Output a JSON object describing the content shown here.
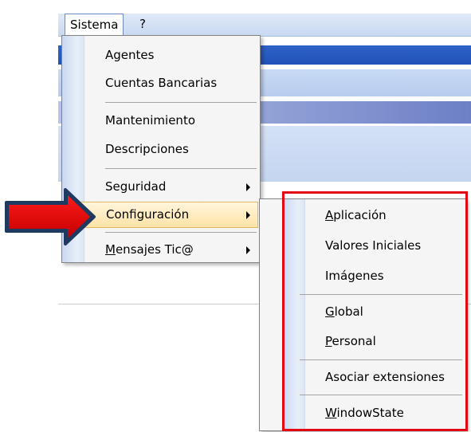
{
  "menubar": {
    "items": [
      {
        "label": "Sistema"
      },
      {
        "label": "?"
      }
    ]
  },
  "sistema_menu": {
    "items": [
      {
        "label": "Agentes"
      },
      {
        "label": "Cuentas Bancarias"
      },
      {
        "label": "Mantenimiento"
      },
      {
        "label": "Descripciones"
      },
      {
        "label": "Seguridad",
        "submenu": true
      },
      {
        "label": "Configuración",
        "submenu": true,
        "highlighted": true
      },
      {
        "label_underline": "M",
        "label_rest": "ensajes Tic@",
        "submenu": true
      }
    ]
  },
  "config_submenu": {
    "items": [
      {
        "label_underline": "A",
        "label_rest": "plicación"
      },
      {
        "label": "Valores Iniciales"
      },
      {
        "label": "Imágenes"
      },
      {
        "label_underline": "G",
        "label_rest": "lobal"
      },
      {
        "label_underline": "P",
        "label_rest": "ersonal"
      },
      {
        "label": "Asociar extensiones"
      },
      {
        "label_underline": "W",
        "label_rest": "indowState"
      }
    ]
  },
  "annotations": {
    "arrow_color": "#e30613",
    "box_color": "#e30613"
  },
  "icons": [
    "submenu-arrow-icon",
    "red-arrow-icon"
  ]
}
